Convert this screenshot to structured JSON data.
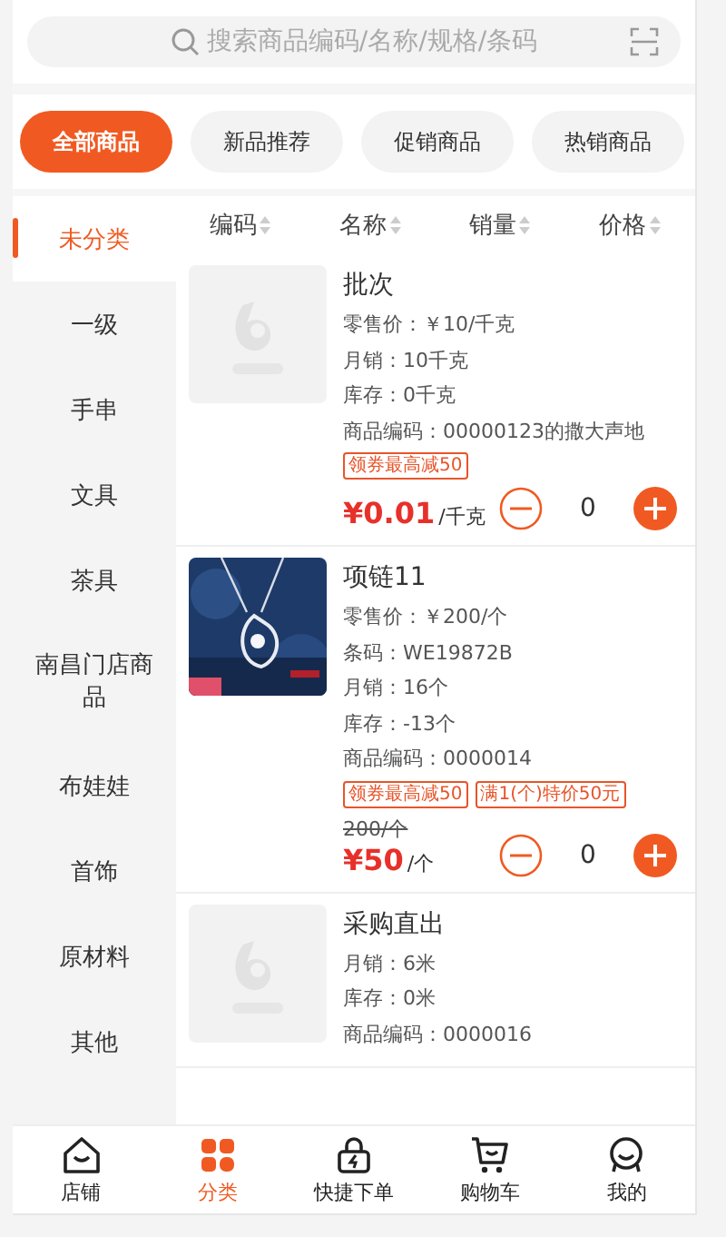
{
  "search": {
    "placeholder": "搜索商品编码/名称/规格/条码"
  },
  "filter_chips": [
    {
      "label": "全部商品",
      "selected": true
    },
    {
      "label": "新品推荐",
      "selected": false
    },
    {
      "label": "促销商品",
      "selected": false
    },
    {
      "label": "热销商品",
      "selected": false
    }
  ],
  "categories": [
    {
      "label": "未分类",
      "selected": true
    },
    {
      "label": "一级",
      "selected": false
    },
    {
      "label": "手串",
      "selected": false
    },
    {
      "label": "文具",
      "selected": false
    },
    {
      "label": "茶具",
      "selected": false
    },
    {
      "label": "南昌门店商品",
      "selected": false
    },
    {
      "label": "布娃娃",
      "selected": false
    },
    {
      "label": "首饰",
      "selected": false
    },
    {
      "label": "原材料",
      "selected": false
    },
    {
      "label": "其他",
      "selected": false
    }
  ],
  "sort_columns": [
    {
      "label": "编码"
    },
    {
      "label": "名称"
    },
    {
      "label": "销量"
    },
    {
      "label": "价格"
    }
  ],
  "products": [
    {
      "name": "批次",
      "kind": "placeholder",
      "details": [
        "零售价：￥10/千克",
        "月销：10千克",
        "库存：0千克",
        "商品编码：00000123的撒大声地"
      ],
      "tags": [
        "领券最高减50"
      ],
      "price": "¥0.01",
      "unit": "/千克",
      "quantity": "0"
    },
    {
      "name": "项链11",
      "kind": "picture",
      "details": [
        "零售价：￥200/个",
        "条码：WE19872B",
        "月销：16个",
        "库存：-13个",
        "商品编码：0000014"
      ],
      "tags": [
        "领券最高减50",
        "满1(个)特价50元"
      ],
      "original_price": "200/个",
      "price": "¥50",
      "unit": "/个",
      "quantity": "0"
    },
    {
      "name": "采购直出",
      "kind": "placeholder",
      "details": [
        "月销：6米",
        "库存：0米",
        "商品编码：0000016"
      ]
    }
  ],
  "tabs": [
    {
      "label": "店铺",
      "selected": false
    },
    {
      "label": "分类",
      "selected": true
    },
    {
      "label": "快捷下单",
      "selected": false
    },
    {
      "label": "购物车",
      "selected": false
    },
    {
      "label": "我的",
      "selected": false
    }
  ]
}
